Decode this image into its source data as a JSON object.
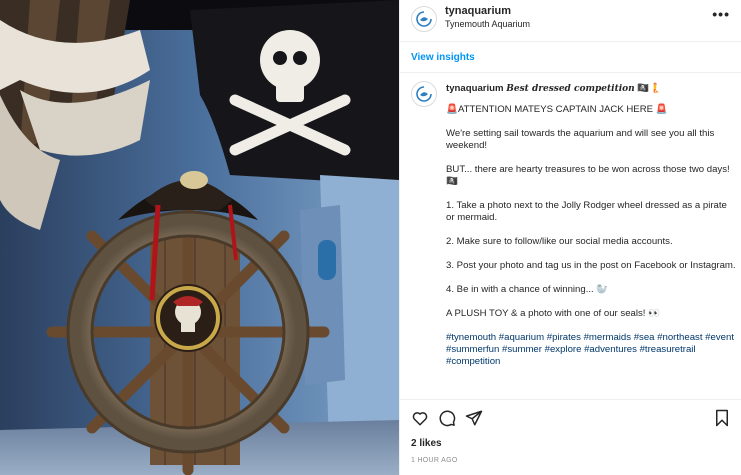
{
  "post": {
    "username": "tynaquarium",
    "location": "Tynemouth Aquarium",
    "view_insights": "View insights",
    "caption": {
      "username": "tynaquarium",
      "title": "Best dressed competition",
      "title_emoji": " 🏴‍☠️🧜",
      "attention": "🚨ATTENTION MATEYS CAPTAIN JACK HERE 🚨",
      "p1": "We're setting sail towards the aquarium and will see you all this weekend!",
      "p2": "BUT... there are hearty treasures to be won across those two days! 🏴‍☠️",
      "p3": "1. Take a photo next to the Jolly Rodger wheel dressed as a pirate or mermaid.",
      "p4": "2. Make sure to follow/like our social media accounts.",
      "p5": "3. Post your photo and tag us in the post on Facebook or Instagram.",
      "p6": "4. Be in with a chance of winning... 🦭",
      "p7": "A PLUSH TOY & a photo with one of our seals! 👀",
      "hashtags": "#tynemouth #aquarium #pirates #mermaids #sea #northeast #event #summerfun #summer #explore #adventures #treasuretrail #competition"
    },
    "likes": "2 likes",
    "time": "1 HOUR AGO"
  },
  "colors": {
    "link_blue": "#0095f6",
    "hashtag_blue": "#00376b",
    "text": "#262626",
    "muted": "#8e8e8e",
    "border": "#efefef"
  },
  "icons": [
    "more-options-icon",
    "heart-icon",
    "comment-icon",
    "share-icon",
    "bookmark-icon",
    "avatar-logo-icon"
  ]
}
